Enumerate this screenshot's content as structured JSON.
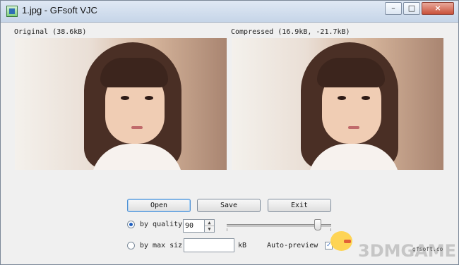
{
  "window": {
    "title": "1.jpg - GFsoft VJC",
    "minimize_glyph": "–",
    "maximize_glyph": "□",
    "close_glyph": "×"
  },
  "images": {
    "original_label": "Original (38.6kB)",
    "compressed_label": "Compressed (16.9kB, -21.7kB)"
  },
  "buttons": {
    "open": "Open",
    "save": "Save",
    "exit": "Exit"
  },
  "quality": {
    "radio_label": "by quality",
    "value": "90",
    "up_glyph": "▲",
    "down_glyph": "▼",
    "slider_percent": 90
  },
  "max_size": {
    "radio_label": "by max siz",
    "value": "",
    "unit": "kB"
  },
  "auto_preview": {
    "label": "Auto-preview",
    "checked_glyph": "✓"
  },
  "watermark": {
    "brand": "3DMGAME",
    "small": "gfsoft.co"
  },
  "colors": {
    "accent": "#1f5fbf",
    "window_bg": "#f0f0f0"
  },
  "icons": {
    "app": "app-icon",
    "spin": "spin-icon"
  }
}
